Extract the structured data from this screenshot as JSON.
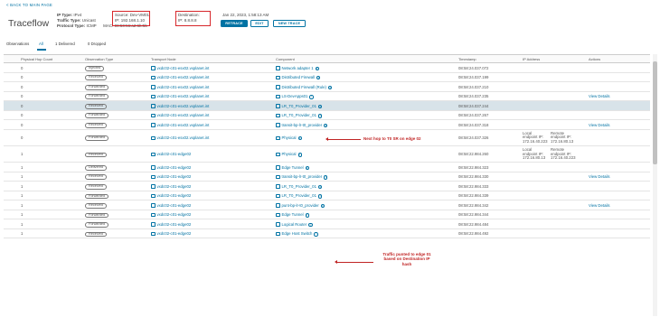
{
  "header": {
    "back_link": "< BACK TO MAIN PAGE",
    "title": "Traceflow",
    "ip_type_label": "IP Type:",
    "ip_type_value": "IPv4",
    "traffic_type_label": "Traffic Type:",
    "traffic_type_value": "Unicast",
    "protocol_label": "Protocol Type:",
    "protocol_value": "ICMP",
    "source_label": "Source:",
    "source_value": "Dev-VM01",
    "source_ip_label": "IP:",
    "source_ip_value": "192.168.1.10",
    "source_mac_label": "MAC:",
    "source_mac_value": "00:50:56:a2:6b:5b",
    "dest_label": "Destination:",
    "dest_ip_label": "IP:",
    "dest_ip_value": "8.8.8.8",
    "date": "Jan 22, 2023, 1:58:13 AM",
    "retrace_label": "RETRACE",
    "edit_label": "EDIT",
    "new_trace_label": "NEW TRACE"
  },
  "tabs": {
    "label": "Observations",
    "all": "All",
    "delivered": "1 Delivered",
    "dropped": "0 Dropped"
  },
  "columns": [
    "Physical Hop Count",
    "Observation Type",
    "Transport Node",
    "Component",
    "Timestamp",
    "IP Address",
    "Actions"
  ],
  "rows": [
    {
      "hop": "0",
      "type": "Injected",
      "tn": "vxdc02-c01-esx02.vxplanet.int",
      "comp": "Network adapter 1",
      "ts": "08:58:24.037.072",
      "act": ""
    },
    {
      "hop": "0",
      "type": "Received",
      "tn": "vxdc02-c01-esx02.vxplanet.int",
      "comp": "Distributed Firewall",
      "ts": "08:58:24.037.199",
      "act": ""
    },
    {
      "hop": "0",
      "type": "Forwarded",
      "tn": "vxdc02-c01-esx02.vxplanet.int",
      "comp": "Distributed Firewall (Rule)",
      "ts": "08:58:24.037.210",
      "act": ""
    },
    {
      "hop": "0",
      "type": "Forwarded",
      "tn": "vxdc02-c01-esx02.vxplanet.int",
      "comp": "LS-DevApps01",
      "ts": "08:58:24.037.235",
      "act": "View Details"
    },
    {
      "hop": "0",
      "type": "Received",
      "tn": "vxdc02-c01-esx02.vxplanet.int",
      "comp": "LR_T0_Provider_01",
      "ts": "08:58:24.037.244",
      "act": ""
    },
    {
      "hop": "0",
      "type": "Forwarded",
      "tn": "vxdc02-c01-esx02.vxplanet.int",
      "comp": "LR_T0_Provider_01",
      "ts": "08:58:24.037.267",
      "act": ""
    },
    {
      "hop": "0",
      "type": "Received",
      "tn": "vxdc02-c01-esx02.vxplanet.int",
      "comp": "transit-bp-lr-t0_provider",
      "ts": "08:58:24.037.318",
      "act": "View Details"
    },
    {
      "hop": "0",
      "type": "Forwarded",
      "tn": "vxdc02-c01-esx02.vxplanet.int",
      "comp": "Physical",
      "ts": "08:58:24.037.326",
      "act": "",
      "ipa1": "Local",
      "ipa2": "endpoint IP:",
      "ipa3": "172.16.40.223",
      "ipb1": "Remote",
      "ipb2": "endpoint IP:",
      "ipb3": "172.16.80.13"
    },
    {
      "hop": "1",
      "type": "Received",
      "tn": "vxdc02-c01-edge02",
      "comp": "Physical",
      "ts": "08:58:22.984.260",
      "act": "",
      "ipa1": "Local",
      "ipa2": "endpoint IP:",
      "ipa3": "172.16.80.13",
      "ipb1": "Remote",
      "ipb2": "endpoint IP:",
      "ipb3": "172.16.40.223"
    },
    {
      "hop": "1",
      "type": "Delivered",
      "tn": "vxdc02-c01-edge02",
      "comp": "Edge Tunnel",
      "ts": "08:58:22.984.323",
      "act": ""
    },
    {
      "hop": "1",
      "type": "Received",
      "tn": "vxdc02-c01-edge02",
      "comp": "transit-bp-lr-t0_provider",
      "ts": "08:58:22.984.330",
      "act": "View Details"
    },
    {
      "hop": "1",
      "type": "Received",
      "tn": "vxdc02-c01-edge02",
      "comp": "LR_T0_Provider_01",
      "ts": "08:58:22.984.333",
      "act": ""
    },
    {
      "hop": "1",
      "type": "Forwarded",
      "tn": "vxdc02-c01-edge02",
      "comp": "LR_T0_Provider_01",
      "ts": "08:58:22.984.339",
      "act": ""
    },
    {
      "hop": "1",
      "type": "Received",
      "tn": "vxdc02-c01-edge02",
      "comp": "punt-bp-lr-t0_provider",
      "ts": "08:58:22.984.342",
      "act": "View Details"
    },
    {
      "hop": "1",
      "type": "Forwarded",
      "tn": "vxdc02-c01-edge02",
      "comp": "Edge Tunnel",
      "ts": "08:58:22.984.344",
      "act": ""
    },
    {
      "hop": "1",
      "type": "Forwarded",
      "tn": "vxdc02-c01-edge02",
      "comp": "Logical Router",
      "ts": "08:58:22.984.484",
      "act": ""
    },
    {
      "hop": "1",
      "type": "Received",
      "tn": "vxdc02-c01-edge02",
      "comp": "Edge Host Switch",
      "ts": "08:58:22.984.492",
      "act": ""
    }
  ],
  "annotations": {
    "next_hop": "Next hop to T0 SR on edge 02",
    "punt_1": "Traffic punted to edge 01",
    "punt_2": "based on Destination IP",
    "punt_3": "hash"
  },
  "colors": {
    "accent": "#0072a3",
    "annotation": "#c02424",
    "selected_row": "#d8e3e9"
  }
}
